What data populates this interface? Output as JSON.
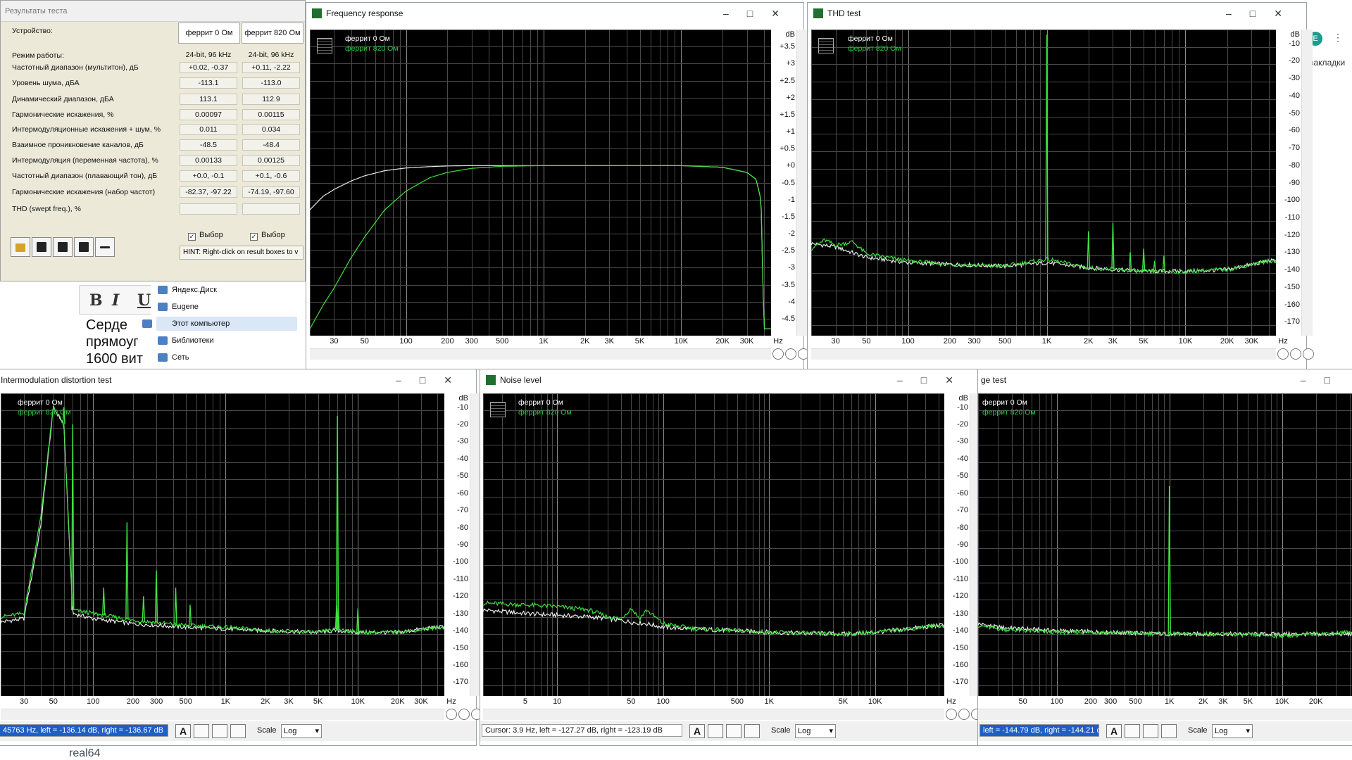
{
  "background": {
    "bookmarks_label": "закладки",
    "avatar_letter": "E",
    "editor_text_lines": [
      "Серде",
      "прямоуг",
      "1600 вит"
    ],
    "explorer_items": [
      "Яндекс.Диск",
      "Eugene",
      "Этот компьютер",
      "Библиотеки",
      "Сеть"
    ],
    "bottom_label": "real64"
  },
  "results": {
    "title": "Результаты теста",
    "device_label": "Устройство:",
    "devices": [
      "феррит 0 Ом",
      "феррит 820 Ом"
    ],
    "rows": [
      {
        "label": "Режим работы:",
        "v1": "24-bit, 96 kHz",
        "v2": "24-bit, 96 kHz",
        "plain": true
      },
      {
        "label": "Частотный диапазон (мультитон), дБ",
        "v1": "+0.02, -0.37",
        "v2": "+0.11, -2.22"
      },
      {
        "label": "Уровень шума, дБА",
        "v1": "-113.1",
        "v2": "-113.0"
      },
      {
        "label": "Динамический диапазон, дБА",
        "v1": "113.1",
        "v2": "112.9"
      },
      {
        "label": "Гармонические искажения, %",
        "v1": "0.00097",
        "v2": "0.00115"
      },
      {
        "label": "Интермодуляционные искажения + шум, %",
        "v1": "0.011",
        "v2": "0.034"
      },
      {
        "label": "Взаимное проникновение каналов, дБ",
        "v1": "-48.5",
        "v2": "-48.4"
      },
      {
        "label": "Интермодуляция (переменная частота), %",
        "v1": "0.00133",
        "v2": "0.00125"
      },
      {
        "label": "Частотный диапазон (плавающий тон), дБ",
        "v1": "+0.0, -0.1",
        "v2": "+0.1, -0.6"
      },
      {
        "label": "Гармонические искажения (набор частот)",
        "v1": "-82.37, -97.22",
        "v2": "-74.19, -97.60"
      },
      {
        "label": "THD (swept freq.), %",
        "v1": "",
        "v2": ""
      }
    ],
    "checkbox_label": "Выбор",
    "hint": "HINT: Right-click on result boxes to v"
  },
  "windows": {
    "fr": {
      "title": "Frequency response"
    },
    "thd": {
      "title": "THD test"
    },
    "imd": {
      "title": "Intermodulation distortion test",
      "cursor": "45763 Hz,  left = -136.14 dB,  right = -136.67 dB"
    },
    "noise": {
      "title": "Noise level",
      "cursor": "Cursor:  3.9 Hz,  left = -127.27 dB,  right = -123.19 dB"
    },
    "cross": {
      "title": "ge test",
      "cursor": "left = -144.79 dB,  right = -144.21 dB"
    }
  },
  "statusbar": {
    "scale_label": "Scale",
    "scale_value": "Log",
    "font_button": "A"
  },
  "chart_data": [
    {
      "name": "Frequency response",
      "type": "line",
      "series": [
        {
          "name": "феррит 0 Ом",
          "color": "#e8e8e8",
          "x": [
            20,
            25,
            30,
            40,
            50,
            70,
            100,
            150,
            200,
            300,
            500,
            1000,
            5000,
            10000,
            20000,
            30000,
            35000,
            38000,
            40000
          ],
          "y": [
            -1.3,
            -0.9,
            -0.7,
            -0.45,
            -0.3,
            -0.15,
            -0.07,
            -0.03,
            -0.01,
            0,
            0,
            0,
            0,
            0,
            -0.05,
            -0.2,
            -0.4,
            -1.0,
            -4.8
          ]
        },
        {
          "name": "феррит 820 Ом",
          "color": "#40e040",
          "x": [
            20,
            25,
            30,
            40,
            50,
            70,
            100,
            150,
            200,
            300,
            500,
            1000,
            5000,
            10000,
            20000,
            30000,
            35000,
            38000,
            40000
          ],
          "y": [
            -4.8,
            -4.1,
            -3.6,
            -2.7,
            -2.1,
            -1.3,
            -0.75,
            -0.35,
            -0.2,
            -0.08,
            -0.02,
            0,
            0,
            0,
            -0.05,
            -0.2,
            -0.4,
            -1.0,
            -4.8
          ]
        }
      ],
      "xlabel": "Hz",
      "ylabel": "dB",
      "x_ticks": [
        "30",
        "50",
        "100",
        "200",
        "300",
        "500",
        "1K",
        "2K",
        "3K",
        "5K",
        "10K",
        "20K",
        "30K"
      ],
      "y_ticks": [
        "+3.5",
        "+3",
        "+2.5",
        "+2",
        "+1.5",
        "+1",
        "+0.5",
        "+0",
        "-0.5",
        "-1",
        "-1.5",
        "-2",
        "-2.5",
        "-3",
        "-3.5",
        "-4",
        "-4.5"
      ],
      "xlim": [
        20,
        45000
      ],
      "ylim": [
        -5,
        4
      ],
      "x_scale": "log",
      "grid": true,
      "legend": "top-left"
    },
    {
      "name": "THD test",
      "type": "line",
      "series": [
        {
          "name": "феррит 0 Ом",
          "color": "#e8e8e8",
          "x": [
            20,
            30,
            50,
            100,
            200,
            500,
            1000,
            2000,
            5000,
            10000,
            20000,
            40000
          ],
          "y": [
            -125,
            -127,
            -133,
            -136,
            -137,
            -138,
            -136,
            -139,
            -141,
            -141,
            -140,
            -135
          ]
        },
        {
          "name": "феррит 820 Ом",
          "color": "#40e040",
          "x": [
            20,
            25,
            30,
            40,
            50,
            100,
            200,
            500,
            1000,
            2000,
            5000,
            10000,
            20000,
            40000
          ],
          "y": [
            -128,
            -123,
            -126,
            -124,
            -131,
            -135,
            -137,
            -138,
            -134,
            -139,
            -141,
            -141,
            -140,
            -135
          ]
        }
      ],
      "peaks": [
        {
          "f": 1000,
          "db": -5
        },
        {
          "f": 2000,
          "db": -118
        },
        {
          "f": 3000,
          "db": -113
        },
        {
          "f": 4000,
          "db": -130
        },
        {
          "f": 5000,
          "db": -128
        },
        {
          "f": 6000,
          "db": -135
        },
        {
          "f": 7000,
          "db": -132
        }
      ],
      "xlabel": "Hz",
      "ylabel": "dB",
      "x_ticks": [
        "30",
        "50",
        "100",
        "200",
        "300",
        "500",
        "1K",
        "2K",
        "3K",
        "5K",
        "10K",
        "20K",
        "30K"
      ],
      "y_ticks": [
        "-10",
        "-20",
        "-30",
        "-40",
        "-50",
        "-60",
        "-70",
        "-80",
        "-90",
        "-100",
        "-110",
        "-120",
        "-130",
        "-140",
        "-150",
        "-160",
        "-170"
      ],
      "xlim": [
        20,
        45000
      ],
      "ylim": [
        -178,
        -2
      ],
      "x_scale": "log",
      "grid": true,
      "legend": "top-left"
    },
    {
      "name": "Intermodulation distortion test",
      "type": "line",
      "series": [
        {
          "name": "феррит 0 Ом",
          "color": "#e8e8e8",
          "x": [
            20,
            30,
            40,
            50,
            60,
            70,
            100,
            200,
            500,
            1000,
            2000,
            5000,
            7000,
            10000,
            20000,
            40000
          ],
          "y": [
            -135,
            -133,
            -80,
            -10,
            -20,
            -130,
            -133,
            -136,
            -138,
            -139,
            -140,
            -141,
            -140,
            -141,
            -141,
            -138
          ]
        },
        {
          "name": "феррит 820 Ом",
          "color": "#40e040",
          "x": [
            20,
            30,
            40,
            50,
            60,
            70,
            100,
            200,
            500,
            1000,
            2000,
            5000,
            7000,
            10000,
            20000,
            40000
          ],
          "y": [
            -132,
            -130,
            -75,
            -10,
            -20,
            -128,
            -130,
            -134,
            -137,
            -138,
            -140,
            -141,
            -139,
            -141,
            -141,
            -138
          ]
        }
      ],
      "peaks": [
        {
          "f": 60,
          "db": -10
        },
        {
          "f": 70,
          "db": -20
        },
        {
          "f": 120,
          "db": -115
        },
        {
          "f": 180,
          "db": -77
        },
        {
          "f": 240,
          "db": -120
        },
        {
          "f": 300,
          "db": -105
        },
        {
          "f": 420,
          "db": -115
        },
        {
          "f": 540,
          "db": -125
        },
        {
          "f": 7000,
          "db": -15
        },
        {
          "f": 6900,
          "db": -125
        },
        {
          "f": 7100,
          "db": -127
        },
        {
          "f": 10000,
          "db": -127
        }
      ],
      "xlabel": "Hz",
      "ylabel": "dB",
      "x_ticks": [
        "30",
        "50",
        "100",
        "200",
        "300",
        "500",
        "1K",
        "2K",
        "3K",
        "5K",
        "10K",
        "20K",
        "30K"
      ],
      "y_ticks": [
        "-10",
        "-20",
        "-30",
        "-40",
        "-50",
        "-60",
        "-70",
        "-80",
        "-90",
        "-100",
        "-110",
        "-120",
        "-130",
        "-140",
        "-150",
        "-160",
        "-170"
      ],
      "xlim": [
        20,
        45000
      ],
      "ylim": [
        -178,
        -2
      ],
      "x_scale": "log",
      "grid": true,
      "legend": "top-left"
    },
    {
      "name": "Noise level",
      "type": "line",
      "series": [
        {
          "name": "феррит 0 Ом",
          "color": "#e8e8e8",
          "x": [
            2,
            5,
            10,
            20,
            30,
            50,
            70,
            100,
            200,
            500,
            1000,
            5000,
            10000,
            40000
          ],
          "y": [
            -128,
            -130,
            -131,
            -132,
            -133,
            -135,
            -136,
            -138,
            -139,
            -140,
            -141,
            -142,
            -141,
            -137
          ]
        },
        {
          "name": "феррит 820 Ом",
          "color": "#40e040",
          "x": [
            2,
            5,
            10,
            20,
            30,
            40,
            50,
            60,
            70,
            100,
            200,
            500,
            1000,
            5000,
            10000,
            40000
          ],
          "y": [
            -124,
            -125,
            -126,
            -128,
            -132,
            -133,
            -127,
            -133,
            -128,
            -136,
            -139,
            -140,
            -141,
            -142,
            -141,
            -137
          ]
        }
      ],
      "xlabel": "Hz",
      "ylabel": "dB",
      "x_ticks": [
        "5",
        "10",
        "50",
        "100",
        "500",
        "1K",
        "5K",
        "10K"
      ],
      "y_ticks": [
        "-10",
        "-20",
        "-30",
        "-40",
        "-50",
        "-60",
        "-70",
        "-80",
        "-90",
        "-100",
        "-110",
        "-120",
        "-130",
        "-140",
        "-150",
        "-160",
        "-170"
      ],
      "xlim": [
        2,
        45000
      ],
      "ylim": [
        -178,
        -2
      ],
      "x_scale": "log",
      "grid": true,
      "legend": "top-left"
    },
    {
      "name": "Crosstalk test",
      "type": "line",
      "series": [
        {
          "name": "феррит 0 Ом",
          "color": "#e8e8e8",
          "x": [
            20,
            30,
            50,
            100,
            300,
            1000,
            3000,
            10000,
            40000
          ],
          "y": [
            -136,
            -138,
            -139,
            -140,
            -141,
            -142,
            -142,
            -142,
            -142
          ]
        },
        {
          "name": "феррит 820 Ом",
          "color": "#40e040",
          "x": [
            20,
            30,
            50,
            100,
            300,
            1000,
            3000,
            10000,
            40000
          ],
          "y": [
            -137,
            -139,
            -140,
            -141,
            -141,
            -142,
            -142,
            -143,
            -141
          ]
        }
      ],
      "peaks": [
        {
          "f": 1000,
          "db": -56
        }
      ],
      "xlabel": "",
      "x_ticks": [
        "50",
        "100",
        "200",
        "300",
        "500",
        "1K",
        "2K",
        "3K",
        "5K",
        "10K",
        "20K"
      ],
      "xlim": [
        20,
        45000
      ],
      "ylim": [
        -178,
        -2
      ],
      "x_scale": "log",
      "grid": true,
      "legend": "top-left"
    }
  ]
}
